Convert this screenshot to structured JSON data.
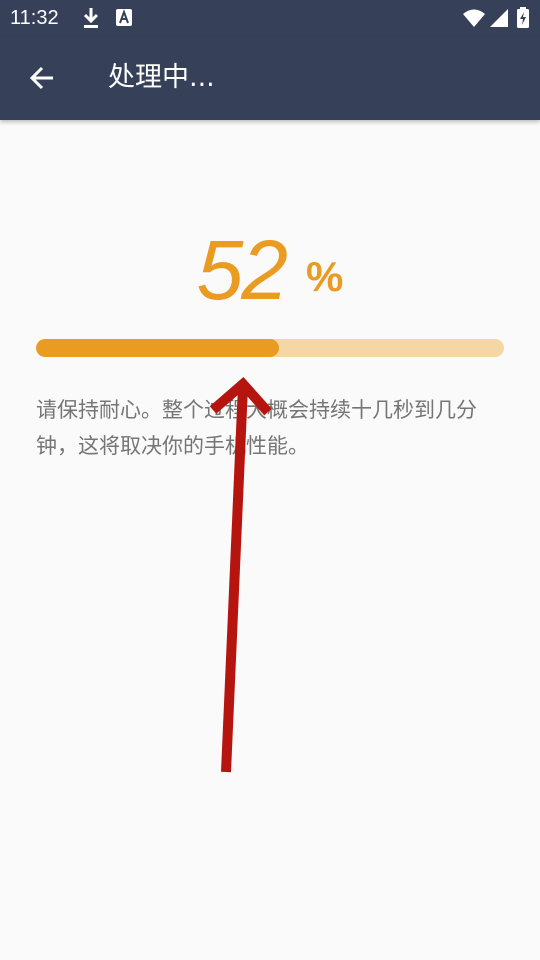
{
  "status_bar": {
    "time": "11:32",
    "icons": [
      "download-icon",
      "text-recognition-icon",
      "wifi-icon",
      "signal-icon",
      "battery-charging-icon"
    ]
  },
  "app_bar": {
    "back_icon": "arrow-back-icon",
    "title": "处理中..."
  },
  "progress": {
    "value": "52",
    "unit": "%",
    "fraction": 0.52
  },
  "hint": "请保持耐心。整个过程大概会持续十几秒到几分钟，这将取决你的手机性能。",
  "colors": {
    "header": "#364159",
    "accent": "#e99b22",
    "track": "#f4d7a4",
    "annotation_arrow": "#b5140f"
  }
}
